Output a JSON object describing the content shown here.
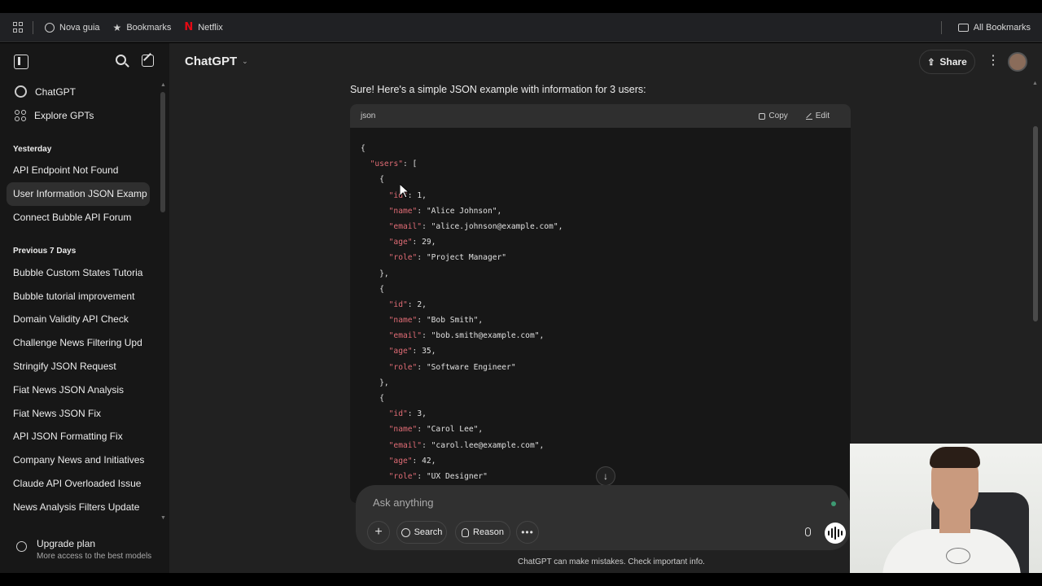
{
  "browser_bookmarks": {
    "items": [
      {
        "label": "Nova guia",
        "icon": "globe-icon"
      },
      {
        "label": "Bookmarks",
        "icon": "star-icon"
      },
      {
        "label": "Netflix",
        "icon": "netflix-icon"
      }
    ],
    "netflix_glyph": "N",
    "all_bookmarks": "All Bookmarks"
  },
  "sidebar": {
    "nav": [
      {
        "label": "ChatGPT",
        "icon": "chatgpt-logo-icon"
      },
      {
        "label": "Explore GPTs",
        "icon": "explore-grid-icon"
      }
    ],
    "sections": [
      {
        "title": "Yesterday",
        "items": [
          "API Endpoint Not Found",
          "User Information JSON Examp",
          "Connect Bubble API Forum"
        ]
      },
      {
        "title": "Previous 7 Days",
        "items": [
          "Bubble Custom States Tutoria",
          "Bubble tutorial improvement",
          "Domain Validity API Check",
          "Challenge News Filtering Upd",
          "Stringify JSON Request",
          "Fiat News JSON Analysis",
          "Fiat News JSON Fix",
          "API JSON Formatting Fix",
          "Company News and Initiatives",
          "Claude API Overloaded Issue",
          "News Analysis Filters Update"
        ]
      }
    ],
    "active_item": "User Information JSON Examp",
    "upgrade": {
      "title": "Upgrade plan",
      "subtitle": "More access to the best models"
    }
  },
  "header": {
    "model": "ChatGPT",
    "share": "Share"
  },
  "message": {
    "intro": "Sure! Here's a simple JSON example with information for 3 users:",
    "code_lang": "json",
    "copy": "Copy",
    "edit": "Edit",
    "code_lines": [
      "{",
      "  \"users\": [",
      "    {",
      "      \"id\": 1,",
      "      \"name\": \"Alice Johnson\",",
      "      \"email\": \"alice.johnson@example.com\",",
      "      \"age\": 29,",
      "      \"role\": \"Project Manager\"",
      "    },",
      "    {",
      "      \"id\": 2,",
      "      \"name\": \"Bob Smith\",",
      "      \"email\": \"bob.smith@example.com\",",
      "      \"age\": 35,",
      "      \"role\": \"Software Engineer\"",
      "    },",
      "    {",
      "      \"id\": 3,",
      "      \"name\": \"Carol Lee\",",
      "      \"email\": \"carol.lee@example.com\",",
      "      \"age\": 42,",
      "      \"role\": \"UX Designer\""
    ]
  },
  "composer": {
    "placeholder": "Ask anything",
    "search": "Search",
    "reason": "Reason"
  },
  "disclaimer": "ChatGPT can make mistakes. Check important info.",
  "colors": {
    "json_key": "#e06c75",
    "json_string": "#98c379",
    "json_number": "#e5a06b"
  }
}
